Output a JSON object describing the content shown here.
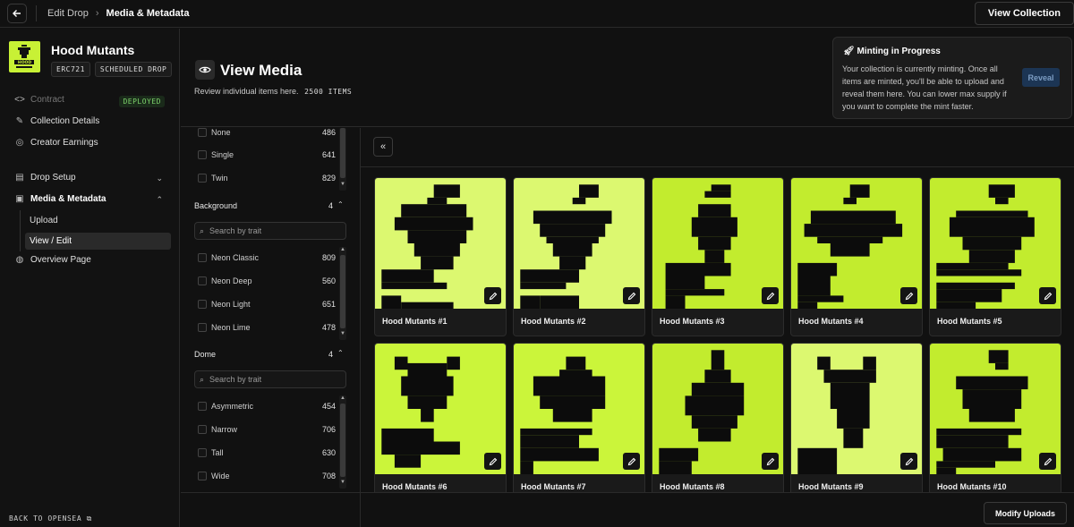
{
  "topbar": {
    "crumbs": [
      "Edit Drop",
      "Media & Metadata"
    ],
    "view_collection": "View Collection"
  },
  "collection": {
    "name": "Hood Mutants",
    "standard": "ERC721",
    "drop_type": "SCHEDULED DROP",
    "logo_icon": "hood-mutants-logo",
    "brand_color": "#c8f135"
  },
  "nav": {
    "contract": "Contract",
    "deployed": "DEPLOYED",
    "collection_details": "Collection Details",
    "creator_earnings": "Creator Earnings",
    "drop_setup": "Drop Setup",
    "media_metadata": "Media & Metadata",
    "upload": "Upload",
    "view_edit": "View / Edit",
    "overview": "Overview Page",
    "back_opensea": "BACK TO OPENSEA"
  },
  "header": {
    "title": "View Media",
    "subtitle": "Review individual items here.",
    "item_count": "2500 ITEMS"
  },
  "minting": {
    "title": "Minting in Progress",
    "body": "Your collection is currently minting. Once all items are minted, you'll be able to upload and reveal them here. You can lower max supply if you want to complete the mint faster.",
    "reveal": "Reveal"
  },
  "filters": {
    "top_traits": [
      {
        "label": "None",
        "count": "486"
      },
      {
        "label": "Single",
        "count": "641"
      },
      {
        "label": "Twin",
        "count": "829"
      }
    ],
    "background": {
      "title": "Background",
      "count": "4",
      "search_placeholder": "Search by trait",
      "traits": [
        {
          "label": "Neon Classic",
          "count": "809"
        },
        {
          "label": "Neon Deep",
          "count": "560"
        },
        {
          "label": "Neon Light",
          "count": "651"
        },
        {
          "label": "Neon Lime",
          "count": "478"
        }
      ]
    },
    "dome": {
      "title": "Dome",
      "count": "4",
      "search_placeholder": "Search by trait",
      "traits": [
        {
          "label": "Asymmetric",
          "count": "454"
        },
        {
          "label": "Narrow",
          "count": "706"
        },
        {
          "label": "Tall",
          "count": "630"
        },
        {
          "label": "Wide",
          "count": "708"
        }
      ]
    }
  },
  "items": [
    {
      "name": "Hood Mutants #1",
      "bg": "#dcf870"
    },
    {
      "name": "Hood Mutants #2",
      "bg": "#dcf870"
    },
    {
      "name": "Hood Mutants #3",
      "bg": "#c2ec2e"
    },
    {
      "name": "Hood Mutants #4",
      "bg": "#c2ec2e"
    },
    {
      "name": "Hood Mutants #5",
      "bg": "#c2ec2e"
    },
    {
      "name": "Hood Mutants #6",
      "bg": "#cbf53a"
    },
    {
      "name": "Hood Mutants #7",
      "bg": "#cbf53a"
    },
    {
      "name": "Hood Mutants #8",
      "bg": "#c2ec2e"
    },
    {
      "name": "Hood Mutants #9",
      "bg": "#dcf870"
    },
    {
      "name": "Hood Mutants #10",
      "bg": "#c2ec2e"
    }
  ],
  "footer": {
    "modify_uploads": "Modify Uploads"
  }
}
